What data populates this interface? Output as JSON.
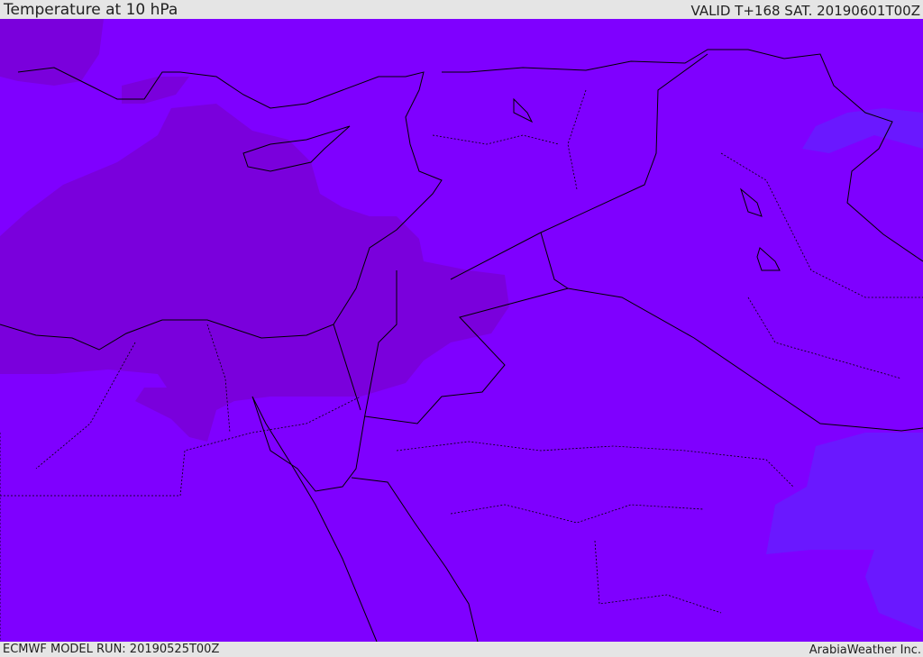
{
  "header": {
    "title": "Temperature at 10 hPa",
    "valid": "VALID T+168 SAT. 20190601T00Z"
  },
  "footer": {
    "model_run": "ECMWF MODEL RUN: 20190525T00Z",
    "brand": "ArabiaWeather Inc."
  },
  "colors": {
    "base_fill": "#7f00ff",
    "warm_fill": "#7a00dc",
    "cool_fill": "#6a18ff",
    "borders": "#000000"
  }
}
